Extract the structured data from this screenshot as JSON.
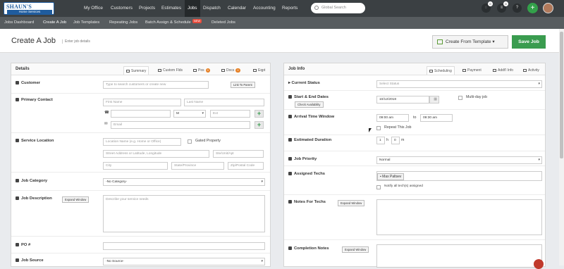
{
  "logo": {
    "line1": "SHAUN'S",
    "line2": "Home Services"
  },
  "topnav": [
    "My Office",
    "Customers",
    "Projects",
    "Estimates",
    "Jobs",
    "Dispatch",
    "Calendar",
    "Accounting",
    "Reports"
  ],
  "search_placeholder": "Global Search",
  "top_icons": {
    "chat_badge": "0",
    "list_badge": "0",
    "help": "?",
    "add": "+"
  },
  "subnav": [
    "Jobs Dashboard",
    "Create A Job",
    "Job Templates",
    "Repeating Jobs",
    "Batch Assign & Schedule",
    "Deleted Jobs"
  ],
  "new_badge": "NEW",
  "page": {
    "title": "Create A Job",
    "subtitle": "Enter job details",
    "template_btn": "Create From Template",
    "save_btn": "Save Job"
  },
  "details": {
    "title": "Details",
    "tabs": [
      "Summary",
      "Custom Flds",
      "Pos",
      "Docs",
      "Eqpt"
    ],
    "pos_count": "0",
    "docs_count": "0",
    "customer_label": "Customer",
    "customer_placeholder": "Type to search customers or create new",
    "link_parent": "Link To Parent",
    "primary_contact": "Primary Contact",
    "first_name": "First Name",
    "last_name": "Last Name",
    "phone_type": "M",
    "ext": "Ext",
    "email": "Email",
    "service_location": "Service Location",
    "location_name": "Location Name (e.g. Home or Office)",
    "gated": "Gated Property",
    "street": "Street Address or Latitude, Longitude",
    "unit": "Ste/Unit/Apt",
    "city": "City",
    "state": "State/Province",
    "zip": "Zip/Postal Code",
    "job_category": "Job Category",
    "no_category": "-No Category-",
    "job_description": "Job Description",
    "expand_window": "Expand Window",
    "desc_placeholder": "Describe your service needs",
    "po": "PO #",
    "job_source": "Job Source",
    "no_source": "-No Source-"
  },
  "jobinfo": {
    "title": "Job Info",
    "tabs": [
      "Scheduling",
      "Payment",
      "Addt'l Info",
      "Activity"
    ],
    "current_status": "Current Status",
    "status_placeholder": "Select Status",
    "start_end": "Start & End Dates",
    "check_availability": "Check Availability",
    "date": "10/12/2018",
    "multi_day": "Multi-day job",
    "arrival_window": "Arrival Time Window",
    "from_time": "09:00 am",
    "to": "to",
    "to_time": "09:30 am",
    "repeat": "Repeat This Job",
    "est_duration": "Estimated Duration",
    "hours": "1",
    "h": "h",
    "mins": "0",
    "m": "m",
    "priority": "Job Priority",
    "priority_value": "Normal",
    "assigned_techs": "Assigned Techs",
    "tech": "Max Paltsev",
    "notify": "Notify all tech(s) assigned",
    "notes_techs": "Notes For Techs",
    "expand_window": "Expand Window",
    "completion_notes": "Completion Notes"
  }
}
